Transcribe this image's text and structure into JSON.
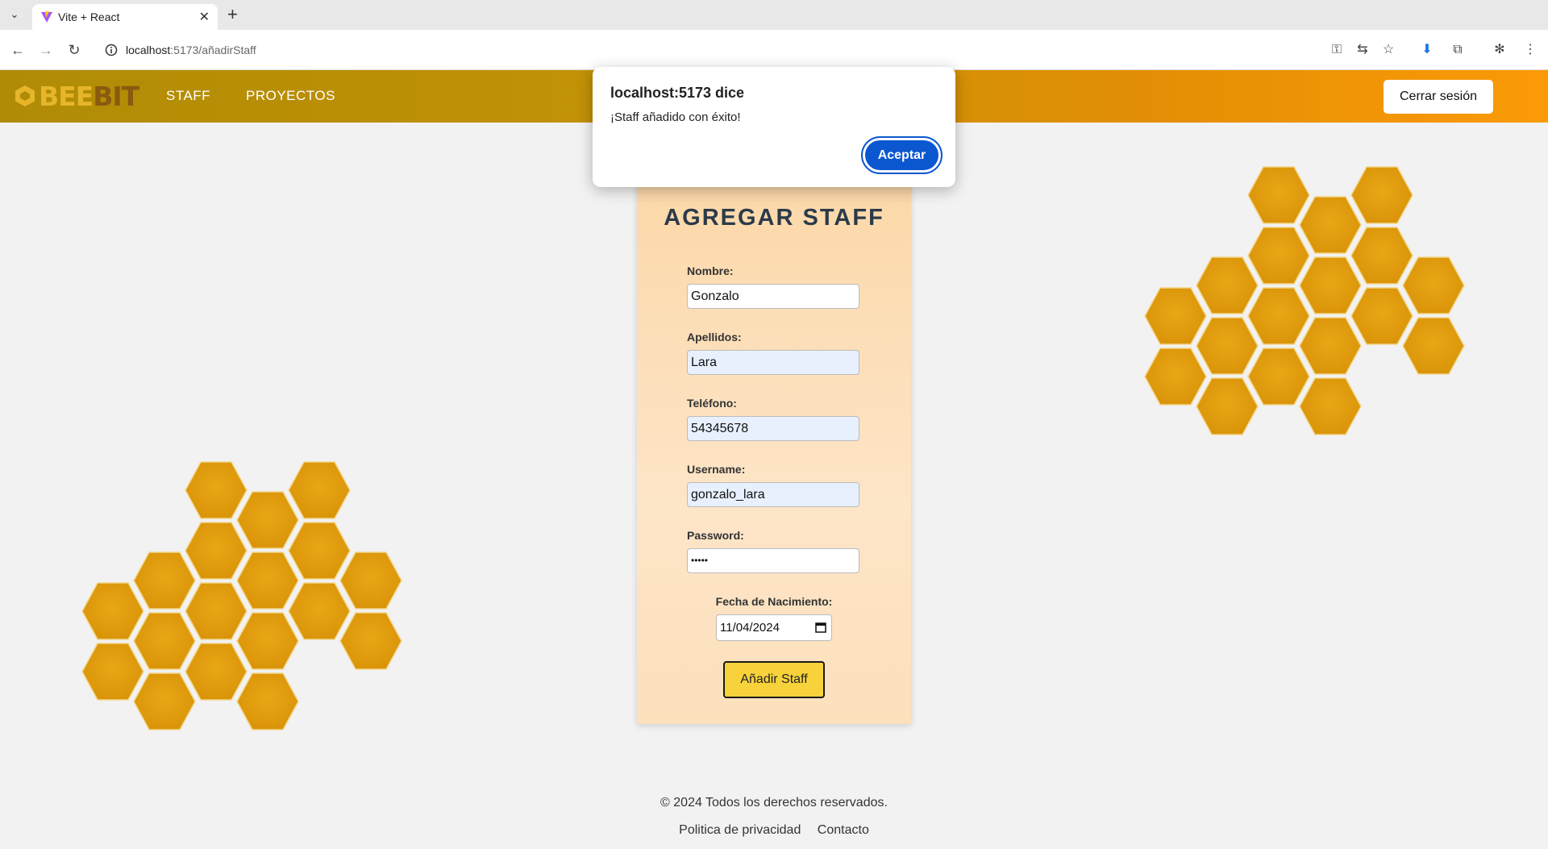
{
  "browser": {
    "tab_title": "Vite + React",
    "url_host": "localhost",
    "url_path": ":5173/añadirStaff"
  },
  "nav": {
    "logo_bee": "BEE",
    "logo_bit": "BIT",
    "links": [
      "STAFF",
      "PROYECTOS"
    ],
    "logout_label": "Cerrar sesión"
  },
  "form": {
    "title": "AGREGAR STAFF",
    "fields": [
      {
        "label": "Nombre:",
        "value": "Gonzalo"
      },
      {
        "label": "Apellidos:",
        "value": "Lara"
      },
      {
        "label": "Teléfono:",
        "value": "54345678"
      },
      {
        "label": "Username:",
        "value": "gonzalo_lara"
      },
      {
        "label": "Password:",
        "value": "•••••"
      }
    ],
    "birth_label": "Fecha de Nacimiento:",
    "birth_value": "11/04/2024",
    "submit_label": "Añadir Staff"
  },
  "dialog": {
    "title": "localhost:5173 dice",
    "message": "¡Staff añadido con éxito!",
    "ok_label": "Aceptar"
  },
  "footer": {
    "copyright": "© 2024 Todos los derechos reservados.",
    "links": [
      "Politica de privacidad",
      "Contacto"
    ]
  },
  "colors": {
    "honey": "#e0a010",
    "accent_blue": "#0b57d0",
    "submit_yellow": "#f8d23a"
  }
}
